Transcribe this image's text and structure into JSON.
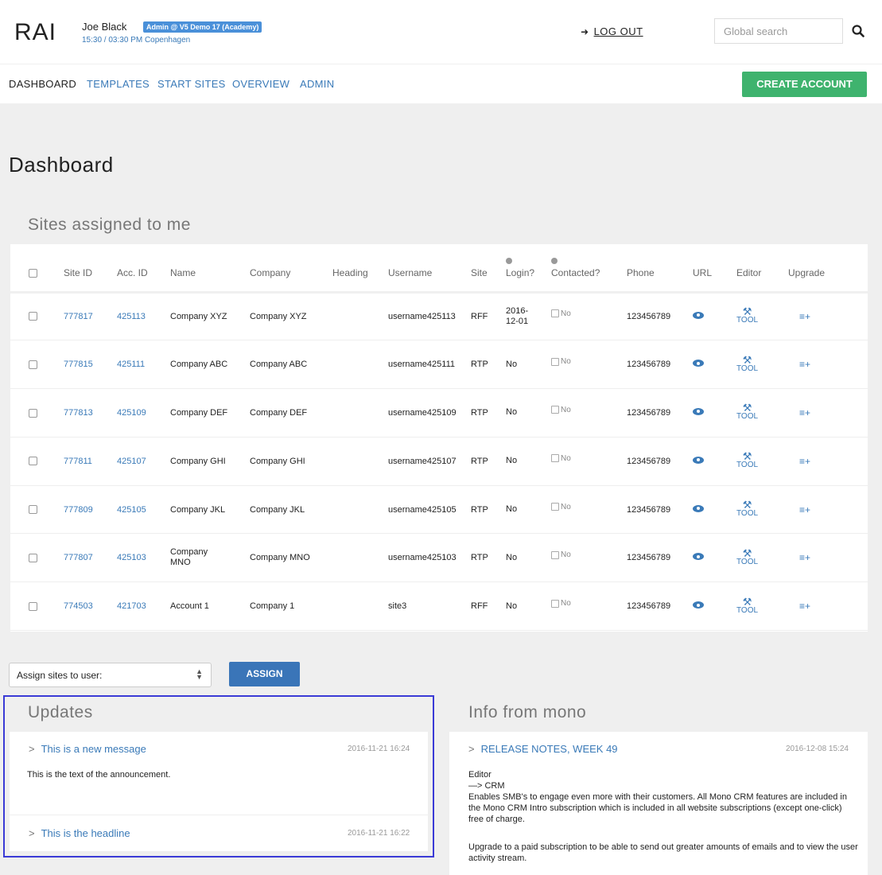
{
  "header": {
    "logo": "RAI",
    "user_name": "Joe Black",
    "user_badge": "Admin @ V5 Demo 17 (Academy)",
    "user_time": "15:30 / 03:30 PM Copenhagen",
    "logout_label": "LOG OUT",
    "search_placeholder": "Global search"
  },
  "nav": {
    "items": [
      "DASHBOARD",
      "TEMPLATES",
      "START SITES",
      "OVERVIEW",
      "ADMIN"
    ],
    "create_account": "CREATE ACCOUNT"
  },
  "page_title": "Dashboard",
  "sites_section": {
    "title": "Sites assigned to me",
    "columns": [
      "Site ID",
      "Acc. ID",
      "Name",
      "Company",
      "Heading",
      "Username",
      "Site",
      "Login?",
      "Contacted?",
      "Phone",
      "URL",
      "Editor",
      "Upgrade"
    ],
    "contacted_label": "No",
    "tool_label": "TOOL",
    "rows": [
      {
        "site_id": "777817",
        "acc_id": "425113",
        "name": "Company XYZ",
        "company": "Company XYZ",
        "heading": "",
        "username": "username425113",
        "site": "RFF",
        "login": "2016-\n12-01",
        "phone": "123456789"
      },
      {
        "site_id": "777815",
        "acc_id": "425111",
        "name": "Company ABC",
        "company": "Company ABC",
        "heading": "",
        "username": "username425111",
        "site": "RTP",
        "login": "No",
        "phone": "123456789"
      },
      {
        "site_id": "777813",
        "acc_id": "425109",
        "name": "Company DEF",
        "company": "Company DEF",
        "heading": "",
        "username": "username425109",
        "site": "RTP",
        "login": "No",
        "phone": "123456789"
      },
      {
        "site_id": "777811",
        "acc_id": "425107",
        "name": "Company GHI",
        "company": "Company GHI",
        "heading": "",
        "username": "username425107",
        "site": "RTP",
        "login": "No",
        "phone": "123456789"
      },
      {
        "site_id": "777809",
        "acc_id": "425105",
        "name": "Company JKL",
        "company": "Company JKL",
        "heading": "",
        "username": "username425105",
        "site": "RTP",
        "login": "No",
        "phone": "123456789"
      },
      {
        "site_id": "777807",
        "acc_id": "425103",
        "name": "Company MNO",
        "company": "Company MNO",
        "heading": "",
        "username": "username425103",
        "site": "RTP",
        "login": "No",
        "phone": "123456789"
      },
      {
        "site_id": "774503",
        "acc_id": "421703",
        "name": "Account 1",
        "company": "Company 1",
        "heading": "",
        "username": "site3",
        "site": "RFF",
        "login": "No",
        "phone": "123456789"
      }
    ]
  },
  "assign": {
    "select_value": "Assign sites to user:",
    "button": "ASSIGN"
  },
  "updates": {
    "title": "Updates",
    "items": [
      {
        "headline": "This is a new message",
        "date": "2016-11-21 16:24",
        "text": "This is the text of the announcement."
      },
      {
        "headline": "This is the headline",
        "date": "2016-11-21 16:22",
        "text": ""
      }
    ]
  },
  "info": {
    "title": "Info from mono",
    "headline": "RELEASE NOTES, WEEK 49",
    "date": "2016-12-08 15:24",
    "lines": [
      "Editor",
      "—> CRM",
      "Enables SMB's to engage even more with their customers. All Mono CRM features are included in the Mono CRM Intro subscription which is included in all website subscriptions (except one-click) free of charge.",
      "Upgrade to a paid subscription to be able to send out greater amounts of emails and to view the user activity stream."
    ]
  }
}
